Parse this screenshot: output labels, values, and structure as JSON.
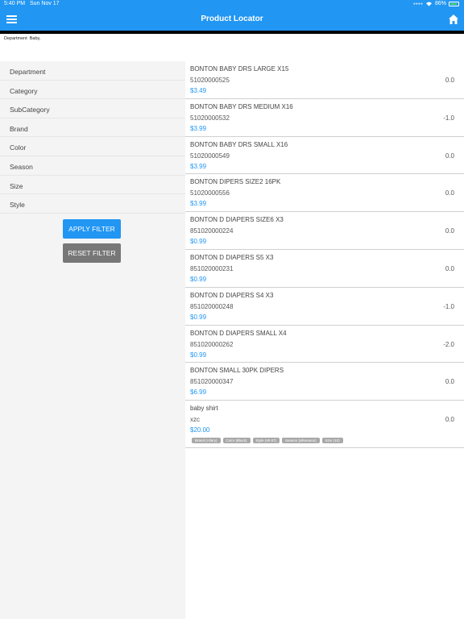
{
  "status": {
    "time": "5:40 PM",
    "date": "Sun Nov 17",
    "battery": "86%"
  },
  "nav": {
    "title": "Product Locator"
  },
  "breadcrumb": {
    "label": "Department",
    "value": "Baby,"
  },
  "filters": [
    "Department",
    "Category",
    "SubCategory",
    "Brand",
    "Color",
    "Season",
    "Size",
    "Style"
  ],
  "buttons": {
    "apply": "APPLY FILTER",
    "reset": "RESET FILTER"
  },
  "products": [
    {
      "name": "BONTON BABY DRS LARGE X15",
      "code": "51020000525",
      "price": "$3.49",
      "qty": "0.0"
    },
    {
      "name": "BONTON BABY DRS MEDIUM X16",
      "code": "51020000532",
      "price": "$3.99",
      "qty": "-1.0"
    },
    {
      "name": "BONTON BABY DRS SMALL X16",
      "code": "51020000549",
      "price": "$3.99",
      "qty": "0.0"
    },
    {
      "name": "BONTON DIPERS SIZE2 16PK",
      "code": "51020000556",
      "price": "$3.99",
      "qty": "0.0"
    },
    {
      "name": "BONTON D DIAPERS SIZE6 X3",
      "code": "851020000224",
      "price": "$0.99",
      "qty": "0.0"
    },
    {
      "name": "BONTON D DIAPERS S5 X3",
      "code": "851020000231",
      "price": "$0.99",
      "qty": "0.0"
    },
    {
      "name": "BONTON D DIAPERS S4 X3",
      "code": "851020000248",
      "price": "$0.99",
      "qty": "-1.0"
    },
    {
      "name": "BONTON D DIAPERS SMALL X4",
      "code": "851020000262",
      "price": "$0.99",
      "qty": "-2.0"
    },
    {
      "name": "BONTON SMALL 30PK DIPERS",
      "code": "851020000347",
      "price": "$6.99",
      "qty": "0.0"
    },
    {
      "name": "baby shirt",
      "code": "xzc",
      "price": "$20.00",
      "qty": "0.0",
      "tags": [
        "Brand (Allary)",
        "Color (Black)",
        "Style (49 87)",
        "Season (allseason)",
        "Size (10)"
      ]
    }
  ]
}
